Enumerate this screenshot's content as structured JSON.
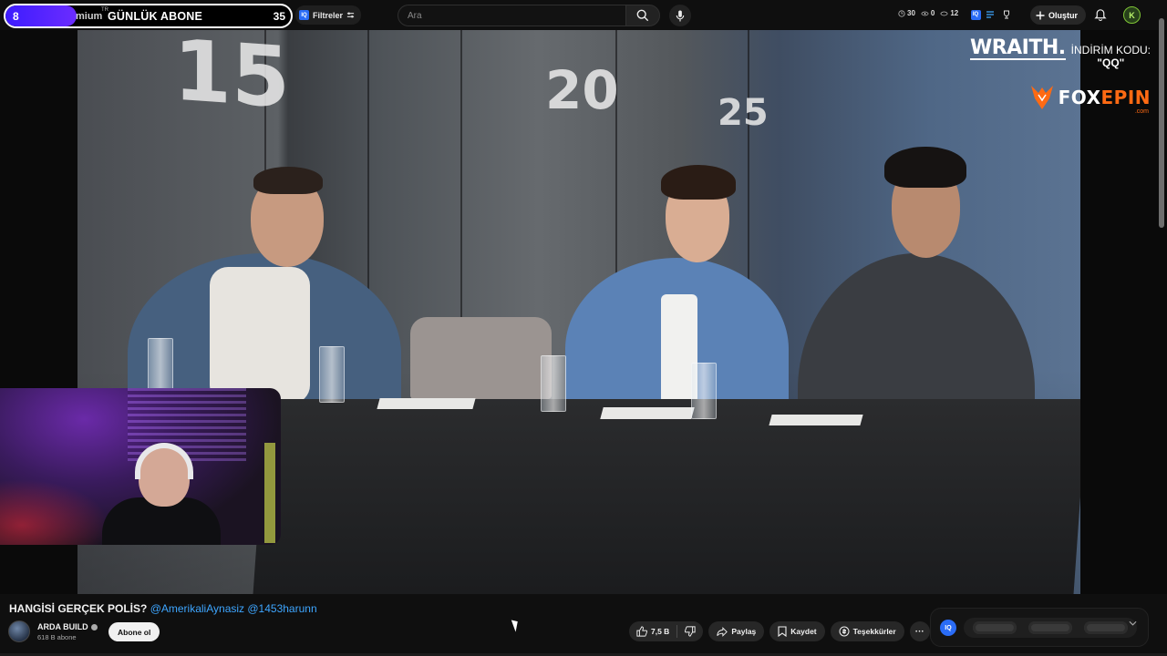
{
  "overlay": {
    "sub_counter": {
      "start": "8",
      "prem_text": "mium",
      "tm": "TR",
      "title": "GÜNLÜK ABONE",
      "goal": "35"
    }
  },
  "topbar": {
    "filter_badge": "IQ",
    "filter_label": "Filtreler",
    "search_placeholder": "Ara",
    "stats": {
      "clock": "30",
      "eye": "0",
      "view": "12"
    },
    "ext_badge": "IQ",
    "create_label": "Oluştur",
    "avatar_letter": "K"
  },
  "video": {
    "wall_numbers": [
      "15",
      "20",
      "25"
    ],
    "sponsor": {
      "brand1": "WRAITH.",
      "code_label": "İNDİRİM KODU:",
      "code": "\"QQ\"",
      "brand2_a": "FOX",
      "brand2_b": "EPIN",
      "brand2_suffix": ".com"
    }
  },
  "info": {
    "title": "HANGİSİ GERÇEK POLİS?",
    "mention1": "@AmerikaliAynasiz",
    "mention2": "@1453harunn",
    "channel_name": "ARDA BUILD",
    "subscribers": "618 B abone",
    "subscribe_label": "Abone ol",
    "like_count": "7,5 B",
    "share_label": "Paylaş",
    "save_label": "Kaydet",
    "thanks_label": "Teşekkürler",
    "more_label": "···",
    "ext_logo": "IQ"
  },
  "colors": {
    "accent_link": "#3ea6ff",
    "progress": "#3d1cff",
    "foxepin_orange": "#ff6a13"
  }
}
